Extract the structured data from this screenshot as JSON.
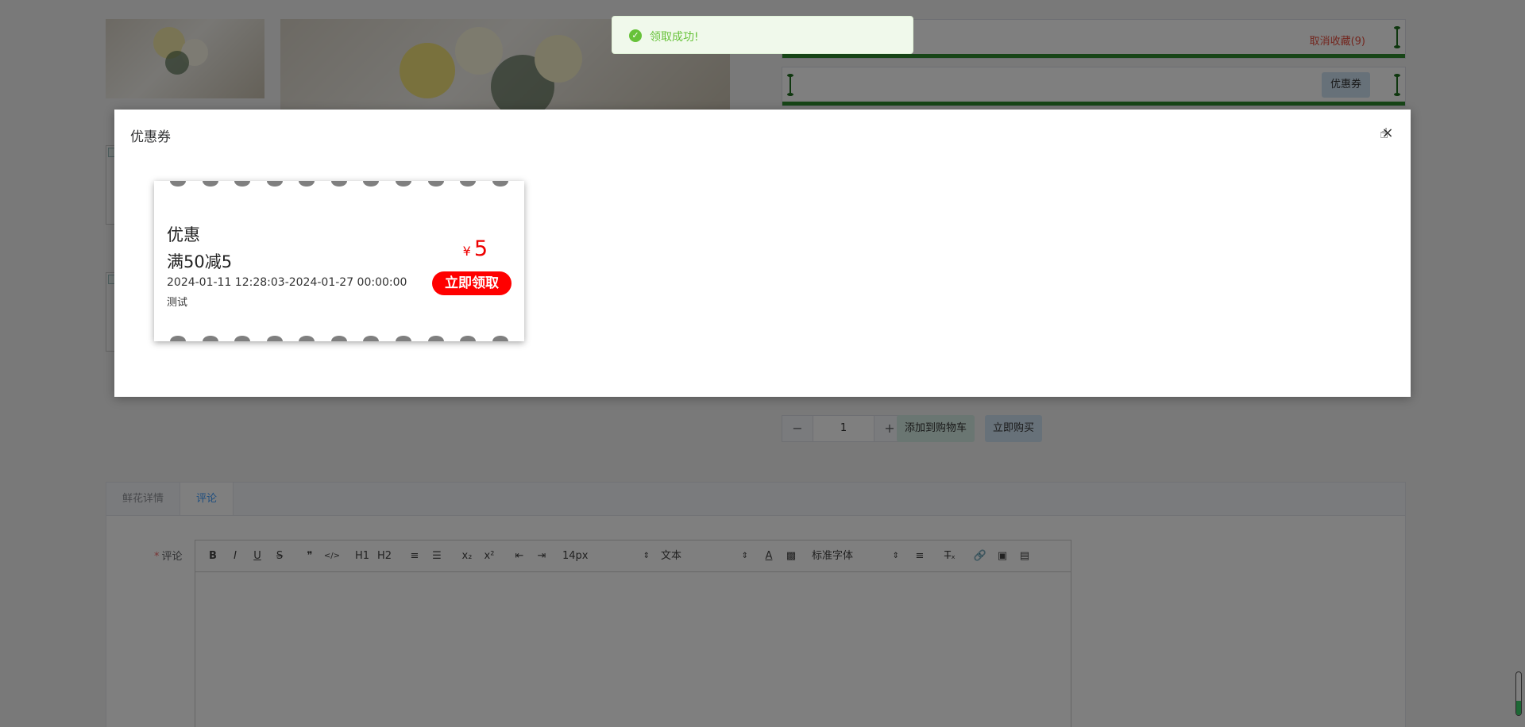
{
  "page": {
    "favorite_label": "取消收藏(9)",
    "coupon_button": "优惠券",
    "quantity": {
      "minus": "−",
      "value": "1",
      "plus": "+"
    },
    "add_to_cart": "添加到购物车",
    "buy_now": "立即购买"
  },
  "tabs": [
    {
      "label": "鲜花详情",
      "active": false
    },
    {
      "label": "评论",
      "active": true
    }
  ],
  "comment_form": {
    "required_mark": "*",
    "label": "评论"
  },
  "editor_toolbar": {
    "bold": "B",
    "italic": "I",
    "underline": "U",
    "strike": "S",
    "quote": "❞",
    "code": "</>",
    "h1": "H1",
    "h2": "H2",
    "ordered_list": "≡",
    "bullet_list": "☰",
    "subscript": "x₂",
    "superscript": "x²",
    "outdent": "⇤",
    "indent": "⇥",
    "size": "14px",
    "header": "文本",
    "font": "标准字体",
    "align": "≡",
    "clean": "T̶ₓ",
    "link": "🔗",
    "image": "▣",
    "video": "▤",
    "text_color": "A",
    "background": "▩"
  },
  "dialog": {
    "title": "优惠券",
    "close": "×"
  },
  "coupons": [
    {
      "name": "优惠",
      "condition": "满50减5",
      "validity": "2024-01-11 12:28:03-2024-01-27 00:00:00",
      "description": "测试",
      "currency": "¥",
      "amount": "5",
      "action": "立即领取"
    }
  ],
  "toast": {
    "icon": "✓",
    "message": "领取成功!"
  },
  "colors": {
    "overlay": "rgba(0,0,0,0.5)",
    "coupon_red": "#ff0000",
    "toast_green": "#67c23a",
    "bar_green": "#2e8b2e"
  }
}
